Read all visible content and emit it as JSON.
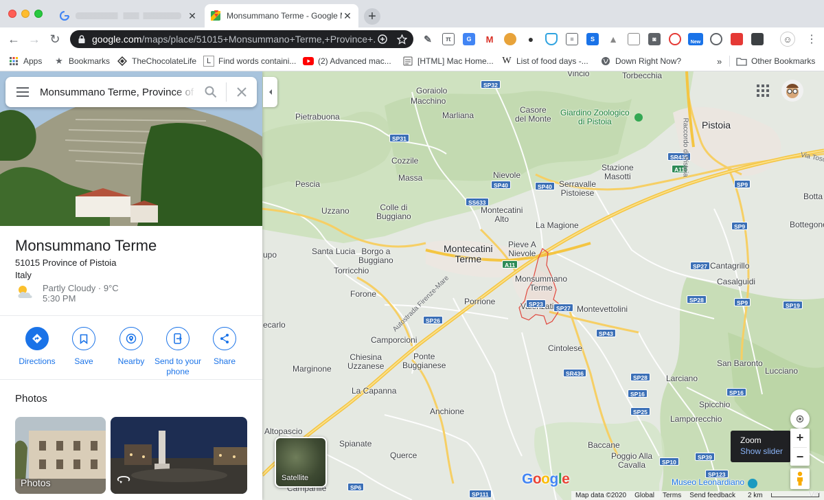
{
  "browser": {
    "tabs": [
      {
        "title": "",
        "favicon": "google-g-icon",
        "active": false
      },
      {
        "title": "Monsummano Terme - Google Maps",
        "favicon": "google-maps-icon",
        "active": true
      }
    ],
    "url_host": "google.com",
    "url_path": "/maps/place/51015+Monsummano+Terme,+Province+...",
    "new_extension_badge": "New",
    "bookmarks": [
      {
        "label": "Apps",
        "icon": "apps-grid-icon"
      },
      {
        "label": "Bookmarks",
        "icon": "star-icon"
      },
      {
        "label": "TheChocolateLife",
        "icon": "diamond-icon"
      },
      {
        "label": "Find words containi...",
        "icon": "letter-l-icon"
      },
      {
        "label": "(2) Advanced mac...",
        "icon": "youtube-icon"
      },
      {
        "label": "[HTML] Mac Home...",
        "icon": "document-icon"
      },
      {
        "label": "List of food days -...",
        "icon": "wikipedia-icon"
      },
      {
        "label": "Down Right Now?",
        "icon": "globe-icon"
      }
    ],
    "overflow_label": "»",
    "other_bookmarks": "Other Bookmarks"
  },
  "panel": {
    "search_value": "Monsummano Terme, Province of Pistoia",
    "place_name": "Monsummano Terme",
    "address_line1": "51015 Province of Pistoia",
    "address_line2": "Italy",
    "weather_line1": "Partly Cloudy · 9°C",
    "weather_line2": "5:30 PM",
    "actions": [
      {
        "label": "Directions",
        "icon": "directions-icon"
      },
      {
        "label": "Save",
        "icon": "bookmark-icon"
      },
      {
        "label": "Nearby",
        "icon": "nearby-icon"
      },
      {
        "label": "Send to your phone",
        "icon": "send-to-phone-icon"
      },
      {
        "label": "Share",
        "icon": "share-icon"
      }
    ],
    "photos_heading": "Photos",
    "photo_label": "Photos"
  },
  "map": {
    "places": [
      {
        "name": "Vincio",
        "kind": "town"
      },
      {
        "name": "Torbecchia",
        "kind": "town"
      },
      {
        "name": "Goraiolo",
        "kind": "town"
      },
      {
        "name": "Macchino",
        "kind": "town"
      },
      {
        "name": "Casore\ndel Monte",
        "kind": "town"
      },
      {
        "name": "Giardino Zoologico\ndi Pistoia",
        "kind": "poi"
      },
      {
        "name": "Pistoia",
        "kind": "city"
      },
      {
        "name": "Pietrabuona",
        "kind": "town"
      },
      {
        "name": "Marliana",
        "kind": "town"
      },
      {
        "name": "Cozzile",
        "kind": "town"
      },
      {
        "name": "Stazione\nMasotti",
        "kind": "town"
      },
      {
        "name": "Massa",
        "kind": "town"
      },
      {
        "name": "Nievole",
        "kind": "town"
      },
      {
        "name": "Pescia",
        "kind": "town"
      },
      {
        "name": "Serravalle\nPistoiese",
        "kind": "town"
      },
      {
        "name": "Botta",
        "kind": "town"
      },
      {
        "name": "Uzzano",
        "kind": "town"
      },
      {
        "name": "Colle di\nBuggiano",
        "kind": "town"
      },
      {
        "name": "Montecatini\nAlto",
        "kind": "town"
      },
      {
        "name": "La Magione",
        "kind": "town"
      },
      {
        "name": "Bottegone",
        "kind": "town"
      },
      {
        "name": "upo",
        "kind": "town"
      },
      {
        "name": "Santa Lucia",
        "kind": "town"
      },
      {
        "name": "Borgo a\nBuggiano",
        "kind": "town"
      },
      {
        "name": "Montecatini\nTerme",
        "kind": "city"
      },
      {
        "name": "Pieve A\nNievole",
        "kind": "town"
      },
      {
        "name": "Cantagrillo",
        "kind": "town"
      },
      {
        "name": "Torricchio",
        "kind": "town"
      },
      {
        "name": "Monsummano\nTerme",
        "kind": "town"
      },
      {
        "name": "Casalguidi",
        "kind": "town"
      },
      {
        "name": "Forone",
        "kind": "town"
      },
      {
        "name": "Porrione",
        "kind": "town"
      },
      {
        "name": "Valenzatico",
        "kind": "town"
      },
      {
        "name": "Montevettolini",
        "kind": "town"
      },
      {
        "name": "ecarlo",
        "kind": "town"
      },
      {
        "name": "Camporcioni",
        "kind": "town"
      },
      {
        "name": "Cintolese",
        "kind": "town"
      },
      {
        "name": "Chiesina\nUzzanese",
        "kind": "town"
      },
      {
        "name": "Ponte\nBuggianese",
        "kind": "town"
      },
      {
        "name": "Marginone",
        "kind": "town"
      },
      {
        "name": "San Baronto",
        "kind": "town"
      },
      {
        "name": "Lucciano",
        "kind": "town"
      },
      {
        "name": "La Capanna",
        "kind": "town"
      },
      {
        "name": "Larciano",
        "kind": "town"
      },
      {
        "name": "Anchione",
        "kind": "town"
      },
      {
        "name": "Spicchio",
        "kind": "town"
      },
      {
        "name": "Lamporecchio",
        "kind": "town"
      },
      {
        "name": "Altopascio",
        "kind": "town"
      },
      {
        "name": "Spianate",
        "kind": "town"
      },
      {
        "name": "Baccane",
        "kind": "town"
      },
      {
        "name": "Querce",
        "kind": "town"
      },
      {
        "name": "Poggio Alla\nCavalla",
        "kind": "town"
      },
      {
        "name": "Campanile",
        "kind": "town"
      },
      {
        "name": "Museo Leonardiano",
        "kind": "poi-blue"
      },
      {
        "name": "Vitt",
        "kind": "town"
      }
    ],
    "road_shields": [
      "SP32",
      "SP31",
      "SR435",
      "A11",
      "SP40",
      "SP40",
      "SS633",
      "SP9",
      "SP9",
      "A11",
      "SP27",
      "SP28",
      "SP9",
      "SP19",
      "SP23",
      "SP27",
      "SP26",
      "SP43",
      "SR436",
      "SP28",
      "SP16",
      "SP16",
      "SP25",
      "SP10",
      "SP39",
      "SP123",
      "SP6",
      "SP111"
    ],
    "road_names": [
      "Autostrada Firenze-Mare",
      "Raccordo di Pistoia",
      "Via Tosc"
    ],
    "satellite_label": "Satellite",
    "zoom_tooltip_title": "Zoom",
    "zoom_tooltip_link": "Show slider",
    "logo": "Google",
    "footer": {
      "map_data": "Map data ©2020",
      "global": "Global",
      "terms": "Terms",
      "feedback": "Send feedback",
      "scale": "2 km"
    },
    "colors": {
      "land": "#e5e9e2",
      "forest": "#c9dfb9",
      "highway": "#f9d77a",
      "road": "#ffffff",
      "boundary": "#e0483e",
      "accent": "#1a73e8"
    }
  }
}
